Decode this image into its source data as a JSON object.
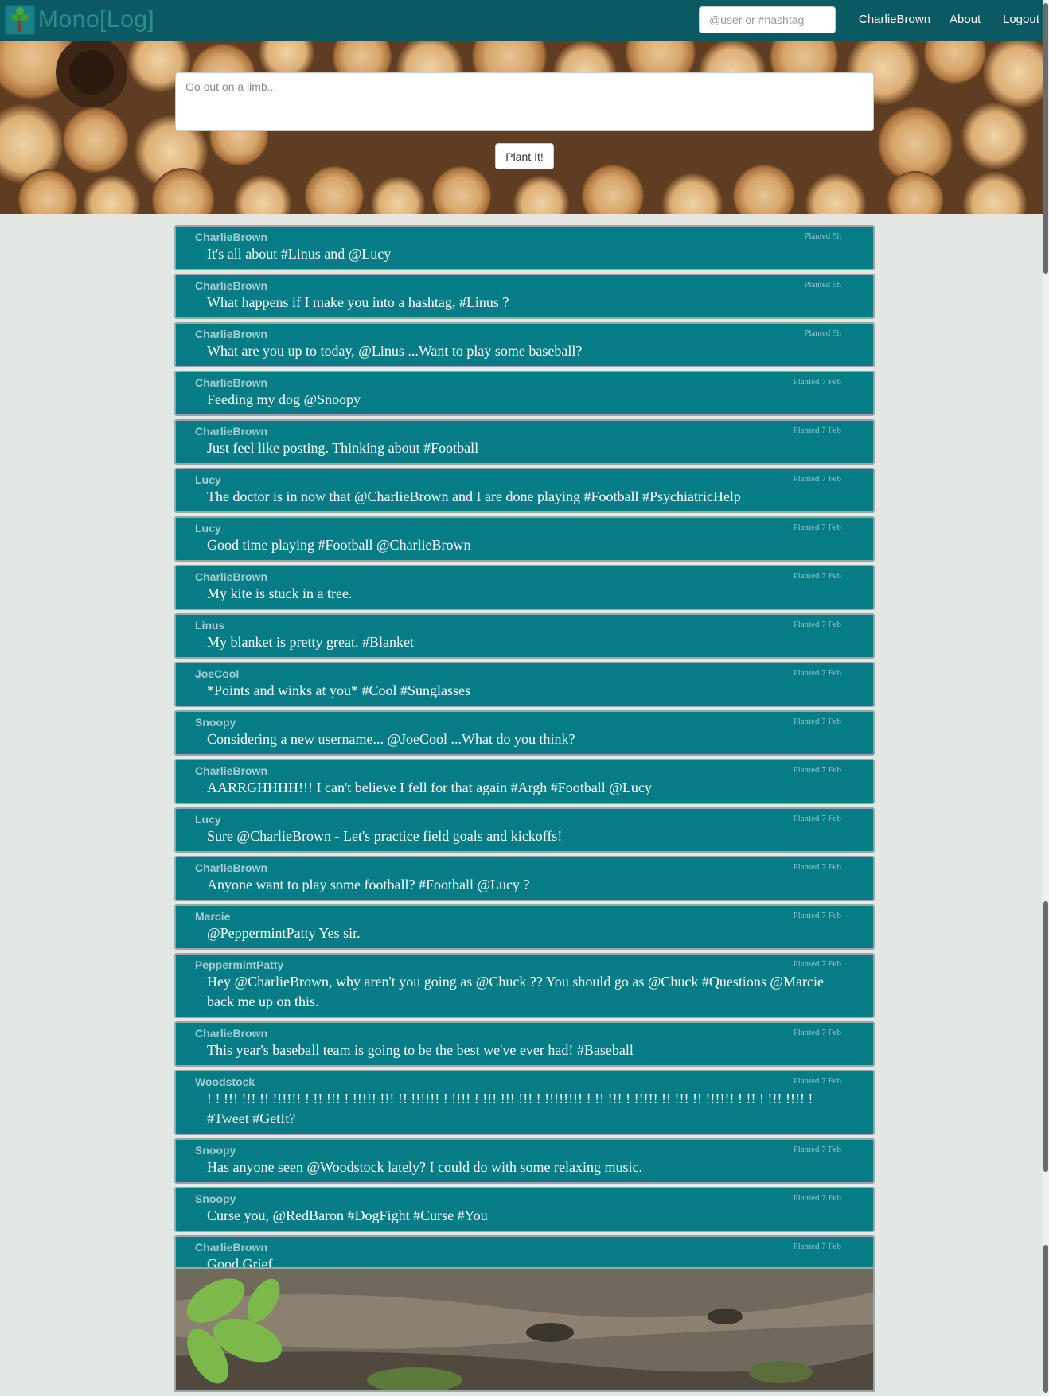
{
  "app": {
    "brand": "Mono[Log]"
  },
  "nav": {
    "search_placeholder": "@user or #hashtag",
    "user_link": "CharlieBrown",
    "about": "About",
    "logout": "Logout"
  },
  "composer": {
    "placeholder": "Go out on a limb...",
    "submit_label": "Plant It!"
  },
  "posts": [
    {
      "user": "CharlieBrown",
      "time": "Planted 5h",
      "text": "It's all about #Linus and @Lucy"
    },
    {
      "user": "CharlieBrown",
      "time": "Planted 5h",
      "text": "What happens if I make you into a hashtag, #Linus ?"
    },
    {
      "user": "CharlieBrown",
      "time": "Planted 5h",
      "text": "What are you up to today, @Linus ...Want to play some baseball?"
    },
    {
      "user": "CharlieBrown",
      "time": "Planted 7 Feb",
      "text": "Feeding my dog @Snoopy"
    },
    {
      "user": "CharlieBrown",
      "time": "Planted 7 Feb",
      "text": "Just feel like posting. Thinking about #Football"
    },
    {
      "user": "Lucy",
      "time": "Planted 7 Feb",
      "text": "The doctor is in now that @CharlieBrown and I are done playing #Football #PsychiatricHelp"
    },
    {
      "user": "Lucy",
      "time": "Planted 7 Feb",
      "text": "Good time playing #Football @CharlieBrown"
    },
    {
      "user": "CharlieBrown",
      "time": "Planted 7 Feb",
      "text": "My kite is stuck in a tree."
    },
    {
      "user": "Linus",
      "time": "Planted 7 Feb",
      "text": "My blanket is pretty great. #Blanket"
    },
    {
      "user": "JoeCool",
      "time": "Planted 7 Feb",
      "text": "*Points and winks at you* #Cool #Sunglasses"
    },
    {
      "user": "Snoopy",
      "time": "Planted 7 Feb",
      "text": "Considering a new username... @JoeCool ...What do you think?"
    },
    {
      "user": "CharlieBrown",
      "time": "Planted 7 Feb",
      "text": "AARRGHHHH!!! I can't believe I fell for that again #Argh #Football @Lucy"
    },
    {
      "user": "Lucy",
      "time": "Planted 7 Feb",
      "text": "Sure @CharlieBrown - Let's practice field goals and kickoffs!"
    },
    {
      "user": "CharlieBrown",
      "time": "Planted 7 Feb",
      "text": "Anyone want to play some football? #Football @Lucy ?"
    },
    {
      "user": "Marcie",
      "time": "Planted 7 Feb",
      "text": "@PeppermintPatty Yes sir."
    },
    {
      "user": "PeppermintPatty",
      "time": "Planted 7 Feb",
      "text": "Hey @CharlieBrown, why aren't you going as @Chuck ?? You should go as @Chuck #Questions @Marcie back me up on this."
    },
    {
      "user": "CharlieBrown",
      "time": "Planted 7 Feb",
      "text": "This year's baseball team is going to be the best we've ever had! #Baseball"
    },
    {
      "user": "Woodstock",
      "time": "Planted 7 Feb",
      "text": "! ! !!! !!! !! !!!!!! ! !! !!! ! !!!!! !!! !! !!!!!! ! !!!! ! !!! !!! !!! ! !!!!!!!! ! !! !!! ! !!!!! !! !!! !! !!!!!! ! !! ! !!! !!!! ! #Tweet #GetIt?"
    },
    {
      "user": "Snoopy",
      "time": "Planted 7 Feb",
      "text": "Has anyone seen @Woodstock lately? I could do with some relaxing music."
    },
    {
      "user": "Snoopy",
      "time": "Planted 7 Feb",
      "text": "Curse you, @RedBaron #DogFight #Curse #You"
    },
    {
      "user": "CharlieBrown",
      "time": "Planted 7 Feb",
      "text": "Good Grief."
    }
  ],
  "colors": {
    "navbar": "#0b5963",
    "post_bg": "#067c87",
    "page_bg": "#e4e8e4"
  }
}
